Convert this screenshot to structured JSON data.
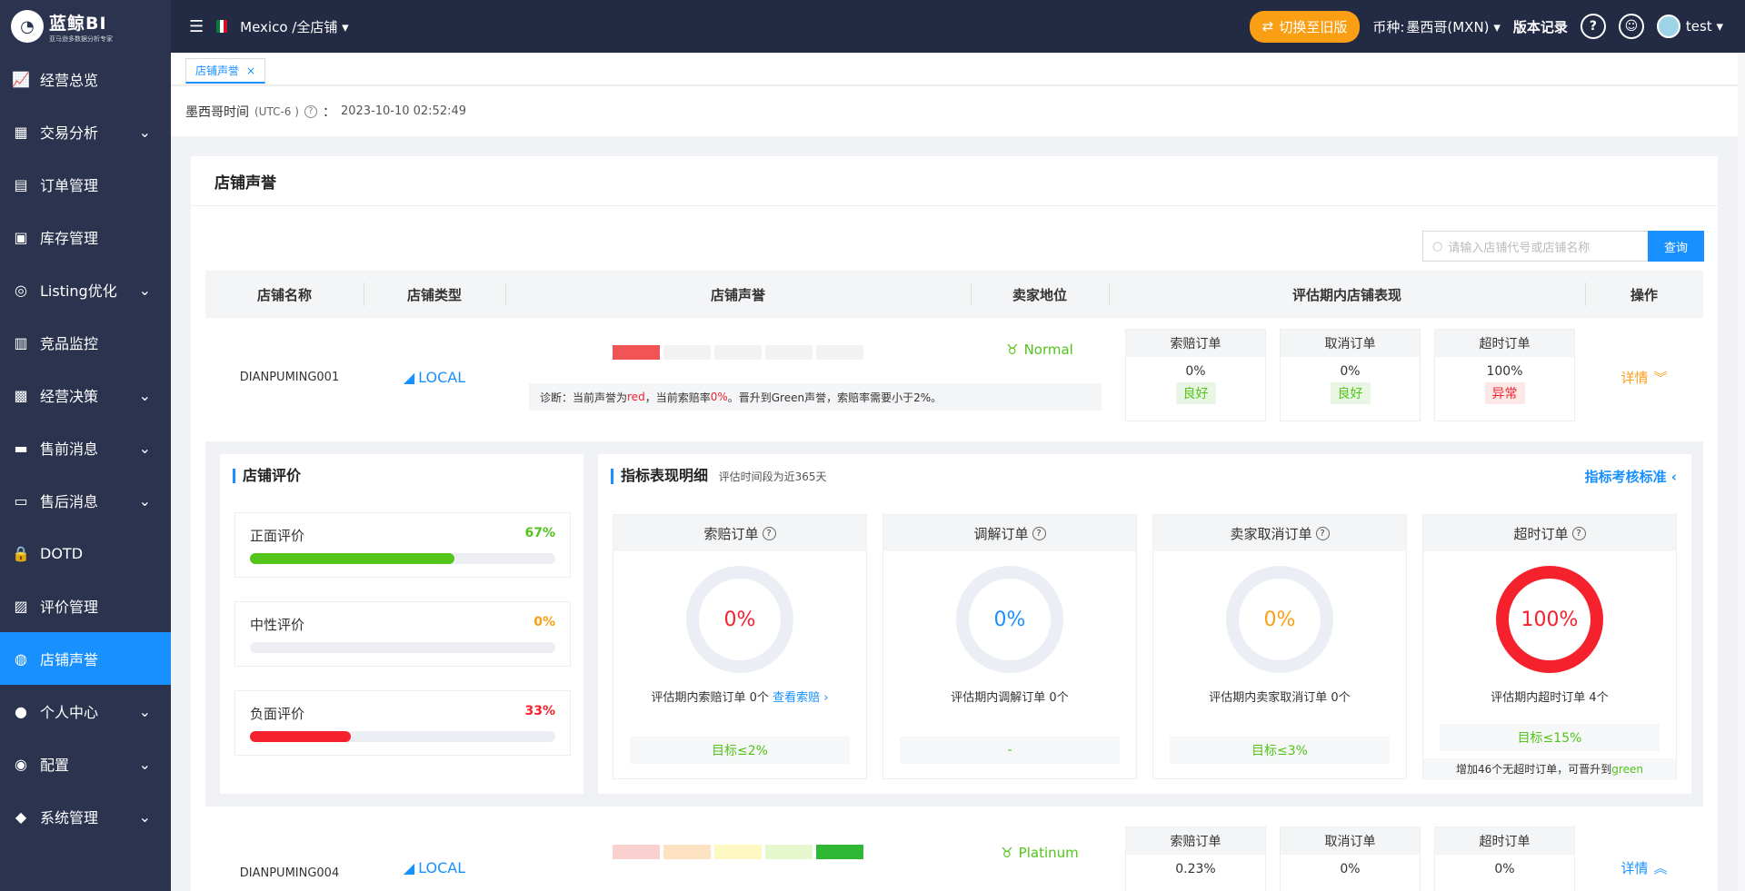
{
  "app": {
    "logo_text": "蓝鲸BI",
    "logo_sub": "亚马逊多数据分析专家"
  },
  "sidebar": {
    "items": [
      {
        "label": "经营总览",
        "icon": "trend-chart-icon",
        "expandable": false
      },
      {
        "label": "交易分析",
        "icon": "image-chart-icon",
        "expandable": true
      },
      {
        "label": "订单管理",
        "icon": "order-doc-icon",
        "expandable": false
      },
      {
        "label": "库存管理",
        "icon": "warehouse-icon",
        "expandable": false
      },
      {
        "label": "Listing优化",
        "icon": "target-icon",
        "expandable": true
      },
      {
        "label": "竞品监控",
        "icon": "monitor-doc-icon",
        "expandable": false
      },
      {
        "label": "经营决策",
        "icon": "decision-board-icon",
        "expandable": true
      },
      {
        "label": "售前消息",
        "icon": "chat-icon",
        "expandable": true
      },
      {
        "label": "售后消息",
        "icon": "chat-double-icon",
        "expandable": true
      },
      {
        "label": "DOTD",
        "icon": "lock-icon",
        "expandable": false
      },
      {
        "label": "评价管理",
        "icon": "review-icon",
        "expandable": false
      },
      {
        "label": "店铺声誉",
        "icon": "reputation-icon",
        "expandable": false,
        "active": true
      },
      {
        "label": "个人中心",
        "icon": "user-icon",
        "expandable": true
      },
      {
        "label": "配置",
        "icon": "config-icon",
        "expandable": true
      },
      {
        "label": "系统管理",
        "icon": "settings-icon",
        "expandable": true
      }
    ]
  },
  "topbar": {
    "store_selector": "Mexico /全店铺",
    "switch_label": "切换至旧版",
    "currency_label": "币种:",
    "currency_value": "墨西哥(MXN)",
    "version_label": "版本记录",
    "user": "test"
  },
  "tabs": [
    {
      "label": "店铺声誉"
    }
  ],
  "timebar": {
    "label": "墨西哥时间",
    "tz": "(UTC-6 )",
    "colon": "：",
    "time": "2023-10-10 02:52:49"
  },
  "page": {
    "title": "店铺声誉",
    "search_placeholder": "请输入店铺代号或店铺名称",
    "query_label": "查询"
  },
  "table": {
    "headers": [
      "店铺名称",
      "店铺类型",
      "店铺声誉",
      "卖家地位",
      "评估期内店铺表现",
      "操作"
    ],
    "rows": [
      {
        "name": "DIANPUMING001",
        "type": "LOCAL",
        "reputation_level": 1,
        "diag_prefix": "诊断：当前声誉为 ",
        "diag_color": "red",
        "diag_mid": " ，当前索赔率 ",
        "diag_rate": "0%",
        "diag_suffix": "。晋升到Green声誉，索赔率需要小于2%。",
        "status": "Normal",
        "perf": [
          {
            "label": "索赔订单",
            "value": "0%",
            "badge": "良好",
            "state": "good"
          },
          {
            "label": "取消订单",
            "value": "0%",
            "badge": "良好",
            "state": "good"
          },
          {
            "label": "超时订单",
            "value": "100%",
            "badge": "异常",
            "state": "bad"
          }
        ],
        "action": "详情"
      },
      {
        "name": "DIANPUMING004",
        "type": "LOCAL",
        "reputation_level": 5,
        "status": "Platinum",
        "perf": [
          {
            "label": "索赔订单",
            "value": "0.23%"
          },
          {
            "label": "取消订单",
            "value": "0%"
          },
          {
            "label": "超时订单",
            "value": "0%"
          }
        ],
        "action": "详情"
      }
    ]
  },
  "detail": {
    "reviews_title": "店铺评价",
    "reviews": [
      {
        "label": "正面评价",
        "percent": "67%",
        "fraction": 0.67,
        "color": "#52c41a"
      },
      {
        "label": "中性评价",
        "percent": "0%",
        "fraction": 0.0,
        "color": "#fa9e14"
      },
      {
        "label": "负面评价",
        "percent": "33%",
        "fraction": 0.33,
        "color": "#f5222d"
      }
    ],
    "metrics_title": "指标表现明细",
    "metrics_sub": "评估时间段为近365天",
    "metrics_link": "指标考核标准",
    "metrics": [
      {
        "label": "索赔订单",
        "value": "0%",
        "color": "#f5222d",
        "desc": "评估期内索赔订单 0个",
        "link": "查看索赔",
        "target": "目标≤2%",
        "fill": 0
      },
      {
        "label": "调解订单",
        "value": "0%",
        "color": "#1890ff",
        "desc": "评估期内调解订单 0个",
        "target": "-",
        "fill": 0
      },
      {
        "label": "卖家取消订单",
        "value": "0%",
        "color": "#fa9e14",
        "desc": "评估期内卖家取消订单 0个",
        "target": "目标≤3%",
        "fill": 0
      },
      {
        "label": "超时订单",
        "value": "100%",
        "color": "#f5222d",
        "desc": "评估期内超时订单 4个",
        "target": "目标≤15%",
        "fill": 1,
        "tip_prefix": "增加46个无超时订单，可晋升到",
        "tip_green": "green"
      }
    ]
  },
  "colors": {
    "accent": "#1890ff",
    "sidebar": "#2b334f",
    "topbar": "#232a44",
    "orange": "#fa9e14",
    "green": "#52c41a",
    "red": "#f5222d"
  }
}
